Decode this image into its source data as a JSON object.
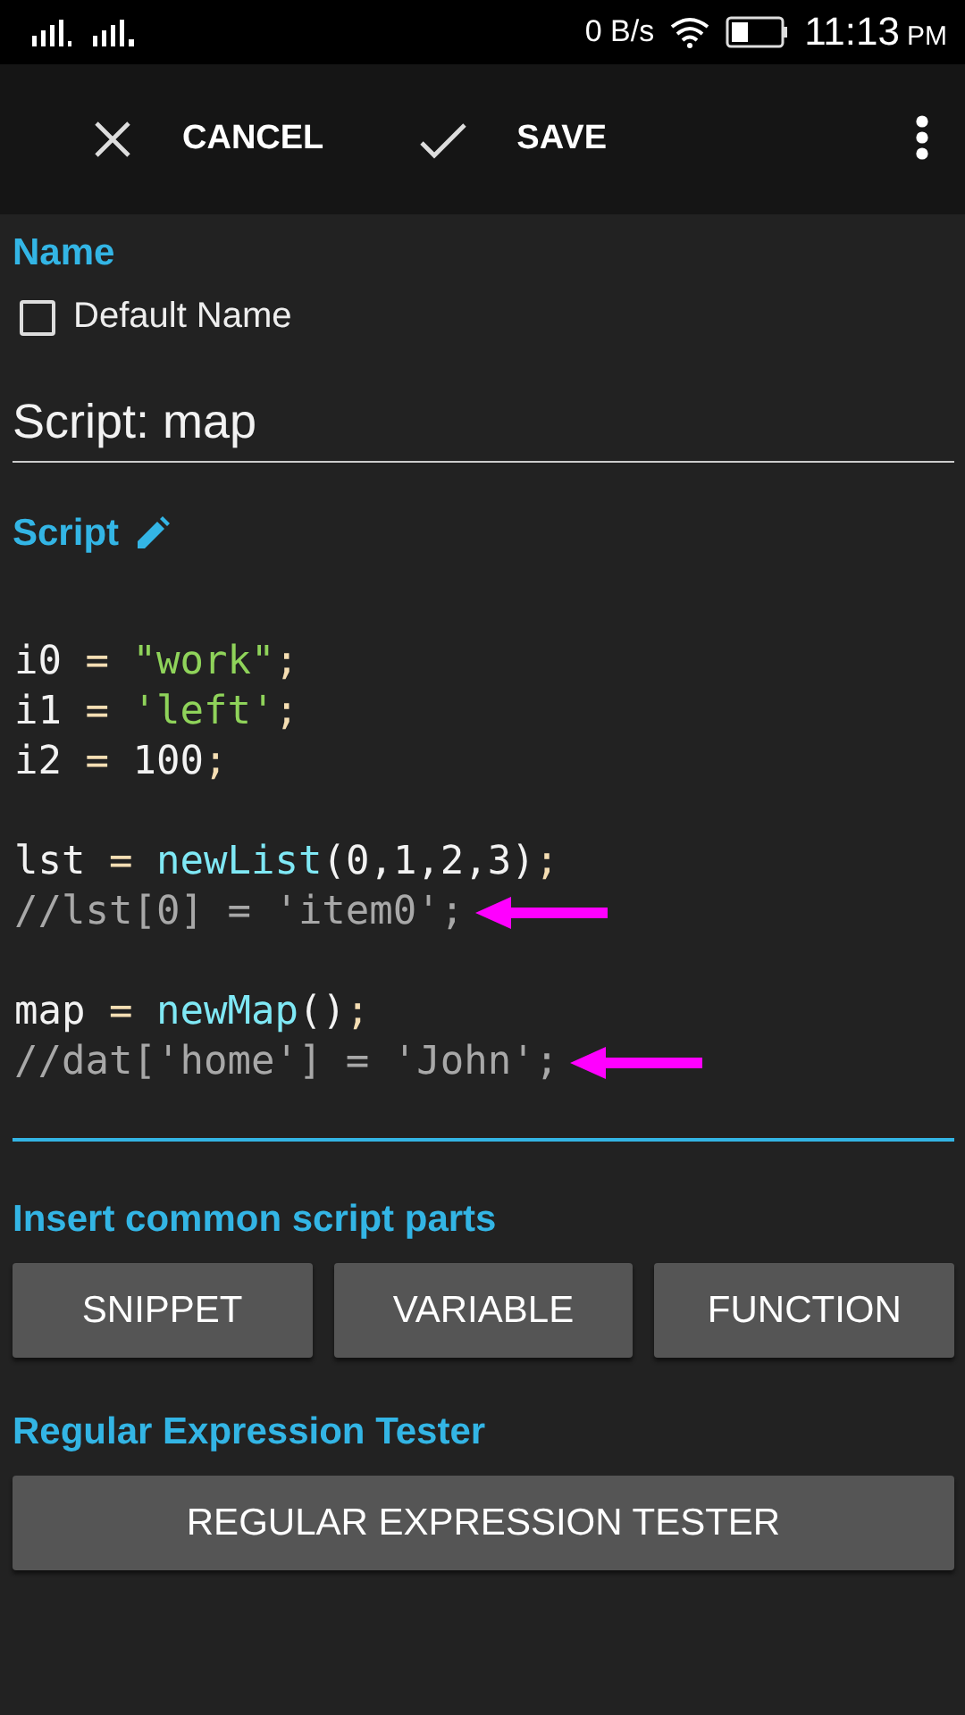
{
  "status_bar": {
    "net_speed": "0 B/s",
    "time": "11:13",
    "ampm": "PM"
  },
  "toolbar": {
    "cancel": "CANCEL",
    "save": "SAVE"
  },
  "name_section": {
    "label": "Name",
    "checkbox": {
      "label": "Default Name",
      "checked": false
    },
    "title_value": "Script: map"
  },
  "script_section": {
    "label": "Script",
    "blocks": [
      [
        {
          "marked": false,
          "tokens": [
            {
              "kind": "plain",
              "text": "i0 "
            },
            {
              "kind": "op",
              "text": "= "
            },
            {
              "kind": "string",
              "text": "\"work\""
            },
            {
              "kind": "op",
              "text": ";"
            }
          ]
        },
        {
          "marked": false,
          "tokens": [
            {
              "kind": "plain",
              "text": "i1 "
            },
            {
              "kind": "op",
              "text": "= "
            },
            {
              "kind": "string",
              "text": "'left'"
            },
            {
              "kind": "op",
              "text": ";"
            }
          ]
        },
        {
          "marked": false,
          "tokens": [
            {
              "kind": "plain",
              "text": "i2 "
            },
            {
              "kind": "op",
              "text": "= "
            },
            {
              "kind": "plain",
              "text": "100"
            },
            {
              "kind": "op",
              "text": ";"
            }
          ]
        }
      ],
      [
        {
          "marked": false,
          "tokens": [
            {
              "kind": "plain",
              "text": "lst "
            },
            {
              "kind": "op",
              "text": "= "
            },
            {
              "kind": "func",
              "text": "newList"
            },
            {
              "kind": "plain",
              "text": "(0,1,2,3)"
            },
            {
              "kind": "op",
              "text": ";"
            }
          ]
        },
        {
          "marked": true,
          "tokens": [
            {
              "kind": "comment",
              "text": "//lst[0] = 'item0';"
            }
          ]
        }
      ],
      [
        {
          "marked": false,
          "tokens": [
            {
              "kind": "plain",
              "text": "map "
            },
            {
              "kind": "op",
              "text": "= "
            },
            {
              "kind": "func",
              "text": "newMap"
            },
            {
              "kind": "plain",
              "text": "()"
            },
            {
              "kind": "op",
              "text": ";"
            }
          ]
        },
        {
          "marked": true,
          "tokens": [
            {
              "kind": "comment",
              "text": "//dat['home'] = 'John';"
            }
          ]
        }
      ]
    ]
  },
  "insert_section": {
    "label": "Insert common script parts",
    "buttons": [
      "SNIPPET",
      "VARIABLE",
      "FUNCTION"
    ]
  },
  "regex_section": {
    "label": "Regular Expression Tester",
    "button": "REGULAR EXPRESSION TESTER"
  }
}
